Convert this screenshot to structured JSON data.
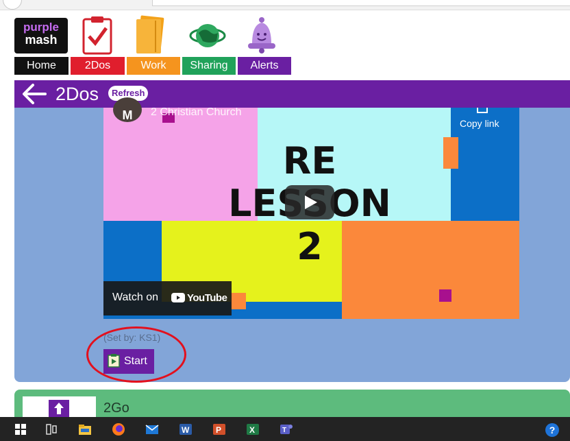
{
  "logo": {
    "line1": "purple",
    "line2": "mash"
  },
  "nav": {
    "tabs": [
      {
        "label": "Home",
        "color": "#111111",
        "icon": "home"
      },
      {
        "label": "2Dos",
        "color": "#e01e2d",
        "icon": "clipboard-check-icon"
      },
      {
        "label": "Work",
        "color": "#f5941e",
        "icon": "folder-icon"
      },
      {
        "label": "Sharing",
        "color": "#20a25a",
        "icon": "globe-icon"
      },
      {
        "label": "Alerts",
        "color": "#6a1fa2",
        "icon": "bell-icon"
      }
    ]
  },
  "header": {
    "title": "2Dos",
    "refresh_label": "Refresh",
    "back_icon": "arrow-left-icon",
    "color": "#6a1fa2"
  },
  "video": {
    "channel_initial": "M",
    "channel_name": "2 Christian Church",
    "copy_link_label": "Copy link",
    "lines": [
      "RE",
      "LESSON",
      "2"
    ],
    "watch_label": "Watch on",
    "youtube_label": "YouTube",
    "play_icon": "play-icon"
  },
  "task": {
    "set_by": "(Set by: KS1)",
    "start_label": "Start",
    "start_icon": "start-play-icon"
  },
  "go_panel": {
    "label": "2Go",
    "icon": "upload-arrow-icon",
    "color": "#5dbb7d"
  },
  "taskbar": {
    "icons": [
      "windows-start-icon",
      "task-view-icon",
      "file-explorer-icon",
      "firefox-icon",
      "mail-icon",
      "word-icon",
      "powerpoint-icon",
      "excel-icon",
      "teams-icon"
    ],
    "help_glyph": "?"
  },
  "colors": {
    "panel": "#82a5d8",
    "accent": "#6a1fa2",
    "highlight": "#e3101d"
  }
}
